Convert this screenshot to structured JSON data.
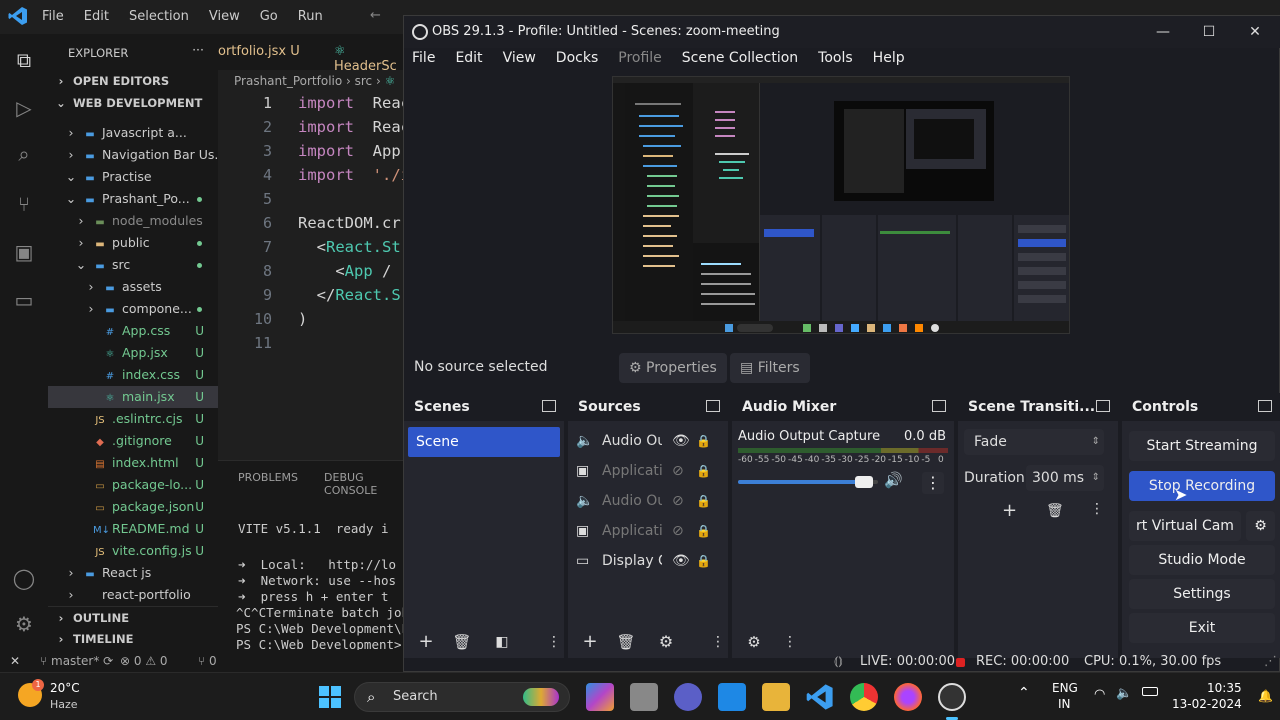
{
  "vscode": {
    "menu": [
      "File",
      "Edit",
      "Selection",
      "View",
      "Go",
      "Run"
    ],
    "explorer_title": "EXPLORER",
    "open_editors": "OPEN EDITORS",
    "workspace": "WEB DEVELOPMENT",
    "tree": [
      {
        "label": "Javascript a...",
        "kind": "folder-blue",
        "indent": 1,
        "chev": "›"
      },
      {
        "label": "Navigation Bar Us...",
        "kind": "folder-blue",
        "indent": 1,
        "chev": "›"
      },
      {
        "label": "Practise",
        "kind": "folder-blue",
        "indent": 1,
        "chev": "⌄"
      },
      {
        "label": "Prashant_Po...",
        "kind": "folder-blue",
        "indent": 1,
        "chev": "⌄",
        "dot": true
      },
      {
        "label": "node_modules",
        "kind": "folder-dim",
        "indent": 2,
        "chev": "›"
      },
      {
        "label": "public",
        "kind": "folder",
        "indent": 2,
        "chev": "›",
        "dot": true
      },
      {
        "label": "src",
        "kind": "folder-blue",
        "indent": 2,
        "chev": "⌄",
        "dot": true
      },
      {
        "label": "assets",
        "kind": "folder-blue",
        "indent": 3,
        "chev": "›"
      },
      {
        "label": "compone...",
        "kind": "folder-blue",
        "indent": 3,
        "chev": "›",
        "dot": true
      },
      {
        "label": "App.css",
        "kind": "css",
        "indent": 3,
        "status": "U"
      },
      {
        "label": "App.jsx",
        "kind": "react",
        "indent": 3,
        "status": "U"
      },
      {
        "label": "index.css",
        "kind": "css",
        "indent": 3,
        "status": "U"
      },
      {
        "label": "main.jsx",
        "kind": "react",
        "indent": 3,
        "status": "U",
        "selected": true
      },
      {
        "label": ".eslintrc.cjs",
        "kind": "js",
        "indent": 2,
        "status": "U"
      },
      {
        "label": ".gitignore",
        "kind": "git",
        "indent": 2,
        "status": "U"
      },
      {
        "label": "index.html",
        "kind": "html",
        "indent": 2,
        "status": "U"
      },
      {
        "label": "package-lo...",
        "kind": "json",
        "indent": 2,
        "status": "U"
      },
      {
        "label": "package.json",
        "kind": "json",
        "indent": 2,
        "status": "U"
      },
      {
        "label": "README.md",
        "kind": "md",
        "indent": 2,
        "status": "U"
      },
      {
        "label": "vite.config.js",
        "kind": "js",
        "indent": 2,
        "status": "U"
      },
      {
        "label": "React js",
        "kind": "folder-blue",
        "indent": 1,
        "chev": "›"
      },
      {
        "label": "react-portfolio",
        "kind": "none",
        "indent": 1,
        "chev": "›"
      }
    ],
    "outline": "OUTLINE",
    "timeline": "TIMELINE",
    "tabs": [
      "ortfolio.jsx U",
      "HeaderSc"
    ],
    "breadcrumb": "Prashant_Portfolio › src › ",
    "code": [
      {
        "n": "1",
        "parts": [
          [
            "kw",
            "import"
          ],
          [
            "",
            "  Reac"
          ]
        ]
      },
      {
        "n": "2",
        "parts": [
          [
            "kw",
            "import"
          ],
          [
            "",
            "  Reac"
          ]
        ]
      },
      {
        "n": "3",
        "parts": [
          [
            "kw",
            "import"
          ],
          [
            "",
            "  App"
          ]
        ]
      },
      {
        "n": "4",
        "parts": [
          [
            "kw",
            "import"
          ],
          [
            "str",
            "  './i"
          ]
        ]
      },
      {
        "n": "5",
        "parts": []
      },
      {
        "n": "6",
        "parts": [
          [
            "",
            "ReactDOM.cr"
          ]
        ]
      },
      {
        "n": "7",
        "parts": [
          [
            "",
            "  <"
          ],
          [
            "ty",
            "React.St"
          ]
        ]
      },
      {
        "n": "8",
        "parts": [
          [
            "",
            "    <"
          ],
          [
            "ty",
            "App"
          ],
          [
            "",
            " /"
          ]
        ]
      },
      {
        "n": "9",
        "parts": [
          [
            "",
            "  </"
          ],
          [
            "ty",
            "React.S"
          ]
        ]
      },
      {
        "n": "10",
        "parts": [
          [
            "",
            ")"
          ]
        ]
      },
      {
        "n": "11",
        "parts": []
      }
    ],
    "panel_tabs": [
      "PROBLEMS",
      "DEBUG CONSOLE"
    ],
    "terminal": [
      "VITE v5.1.1  ready i",
      "",
      "➜  Local:   http://lo",
      "➜  Network: use --hos",
      "➜  press h + enter t",
      "^C^CTerminate batch job",
      "PS C:\\Web Development\\P",
      "PS C:\\Web Development>"
    ],
    "status": {
      "branch": "master*",
      "errors": "⊗ 0",
      "warnings": "⚠ 0",
      "ports": "⑂ 0"
    }
  },
  "obs": {
    "title": "OBS 29.1.3 - Profile: Untitled - Scenes: zoom-meeting",
    "menu": [
      "File",
      "Edit",
      "View",
      "Docks",
      "Profile",
      "Scene Collection",
      "Tools",
      "Help"
    ],
    "no_source": "No source selected",
    "properties": "Properties",
    "filters": "Filters",
    "docks": {
      "scenes": "Scenes",
      "sources": "Sources",
      "audio_mixer": "Audio Mixer",
      "transitions": "Scene Transiti...",
      "controls": "Controls"
    },
    "scene_items": [
      "Scene"
    ],
    "sources": [
      {
        "name": "Audio Ou",
        "icon": "speaker-icon",
        "visible": true
      },
      {
        "name": "Applicati",
        "icon": "window-icon",
        "visible": false
      },
      {
        "name": "Audio Ou",
        "icon": "speaker-icon",
        "visible": false
      },
      {
        "name": "Applicati",
        "icon": "window-icon",
        "visible": false
      },
      {
        "name": "Display C",
        "icon": "monitor-icon",
        "visible": true
      }
    ],
    "mixer": {
      "name": "Audio Output Capture",
      "db": "0.0 dB",
      "scale": [
        "-60",
        "-55",
        "-50",
        "-45",
        "-40",
        "-35",
        "-30",
        "-25",
        "-20",
        "-15",
        "-10",
        "-5",
        "0"
      ],
      "volume": 0.92
    },
    "transition": {
      "type": "Fade",
      "duration_label": "Duration",
      "duration": "300 ms"
    },
    "controls": {
      "start_streaming": "Start Streaming",
      "stop_recording": "Stop Recording",
      "virtual_cam": "rt Virtual Cam",
      "studio_mode": "Studio Mode",
      "settings": "Settings",
      "exit": "Exit"
    },
    "status": {
      "live": "LIVE: 00:00:00",
      "rec": "REC: 00:00:00",
      "cpu": "CPU: 0.1%, 30.00 fps"
    },
    "colors": {
      "accent": "#2f56c9",
      "bg": "#1b1c22",
      "dock": "#25262e"
    }
  },
  "taskbar": {
    "weather_temp": "20°C",
    "weather_desc": "Haze",
    "weather_badge": "1",
    "search": "Search",
    "lang": "ENG",
    "region": "IN",
    "time": "10:35",
    "date": "13-02-2024"
  }
}
